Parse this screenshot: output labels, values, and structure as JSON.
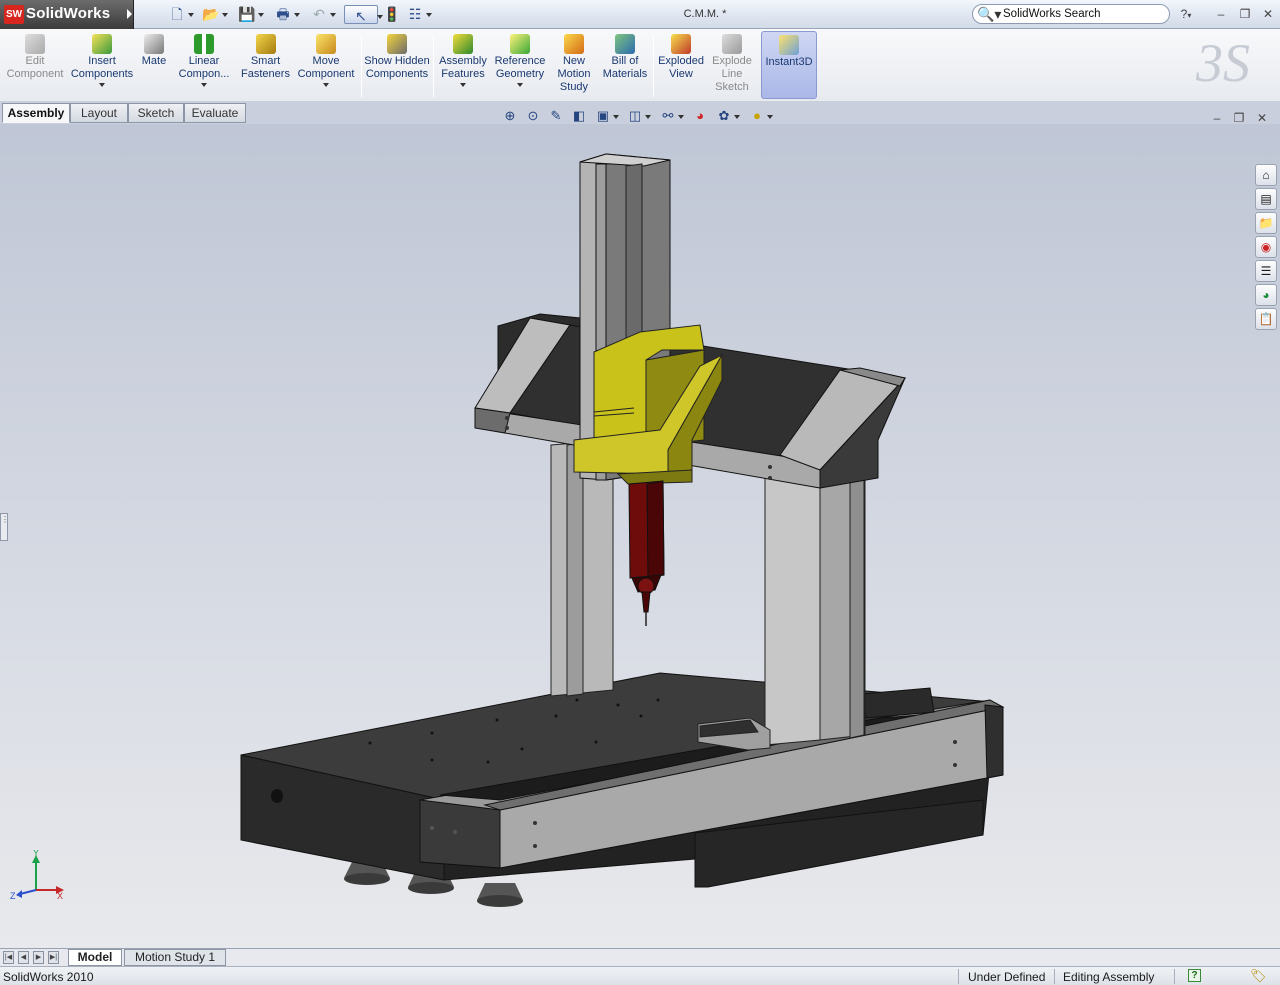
{
  "app": {
    "logo_badge": "SW",
    "logo_text": "SolidWorks",
    "document_title": "C.M.M. *",
    "search_placeholder": "SolidWorks Search",
    "help_glyph": "?",
    "window_controls": [
      "–",
      "❐",
      "✕"
    ]
  },
  "quick_access": [
    "new-document-icon",
    "open-icon",
    "save-icon",
    "print-icon",
    "undo-icon",
    "select-icon",
    "rebuild-icon",
    "options-icon"
  ],
  "command_manager": {
    "tools": [
      {
        "label": "Edit Component",
        "icon": "edit-component-icon",
        "enabled": false
      },
      {
        "label": "Insert Components",
        "icon": "insert-components-icon",
        "enabled": true
      },
      {
        "label": "Mate",
        "icon": "mate-icon",
        "enabled": true
      },
      {
        "label": "Linear Compon...",
        "icon": "linear-pattern-icon",
        "enabled": true
      },
      {
        "label": "Smart Fasteners",
        "icon": "smart-fasteners-icon",
        "enabled": true
      },
      {
        "label": "Move Component",
        "icon": "move-component-icon",
        "enabled": true
      },
      {
        "label": "Show Hidden Components",
        "icon": "show-hidden-icon",
        "enabled": true
      },
      {
        "label": "Assembly Features",
        "icon": "assembly-features-icon",
        "enabled": true
      },
      {
        "label": "Reference Geometry",
        "icon": "reference-geometry-icon",
        "enabled": true
      },
      {
        "label": "New Motion Study",
        "icon": "motion-study-icon",
        "enabled": true
      },
      {
        "label": "Bill of Materials",
        "icon": "bom-icon",
        "enabled": true
      },
      {
        "label": "Exploded View",
        "icon": "exploded-view-icon",
        "enabled": true
      },
      {
        "label": "Explode Line Sketch",
        "icon": "explode-line-icon",
        "enabled": false
      },
      {
        "label": "Instant3D",
        "icon": "instant3d-icon",
        "enabled": true
      }
    ]
  },
  "tabs": [
    {
      "label": "Assembly",
      "active": true
    },
    {
      "label": "Layout",
      "active": false
    },
    {
      "label": "Sketch",
      "active": false
    },
    {
      "label": "Evaluate",
      "active": false
    }
  ],
  "view_toolbar": [
    "zoom-to-fit-icon",
    "zoom-area-icon",
    "previous-view-icon",
    "section-view-icon",
    "view-orientation-icon",
    "display-style-icon",
    "hide-show-icon",
    "edit-appearance-icon",
    "apply-scene-icon",
    "view-settings-icon"
  ],
  "task_pane": [
    "home-icon",
    "design-library-icon",
    "file-explorer-icon",
    "search-results-icon",
    "view-palette-icon",
    "appearances-icon",
    "custom-properties-icon"
  ],
  "triad": {
    "x": "X",
    "y": "Y",
    "z": "Z"
  },
  "bottom_tabs": [
    {
      "label": "Model",
      "active": true
    },
    {
      "label": "Motion Study 1",
      "active": false
    }
  ],
  "status": {
    "version": "SolidWorks 2010",
    "definition": "Under Defined",
    "mode": "Editing Assembly",
    "help_glyph": "?"
  },
  "colors": {
    "accent_yellow": "#c8c21a",
    "probe_red": "#6e0b0b",
    "granite": "#2d2d2d",
    "steel": "#9a9a9a"
  }
}
